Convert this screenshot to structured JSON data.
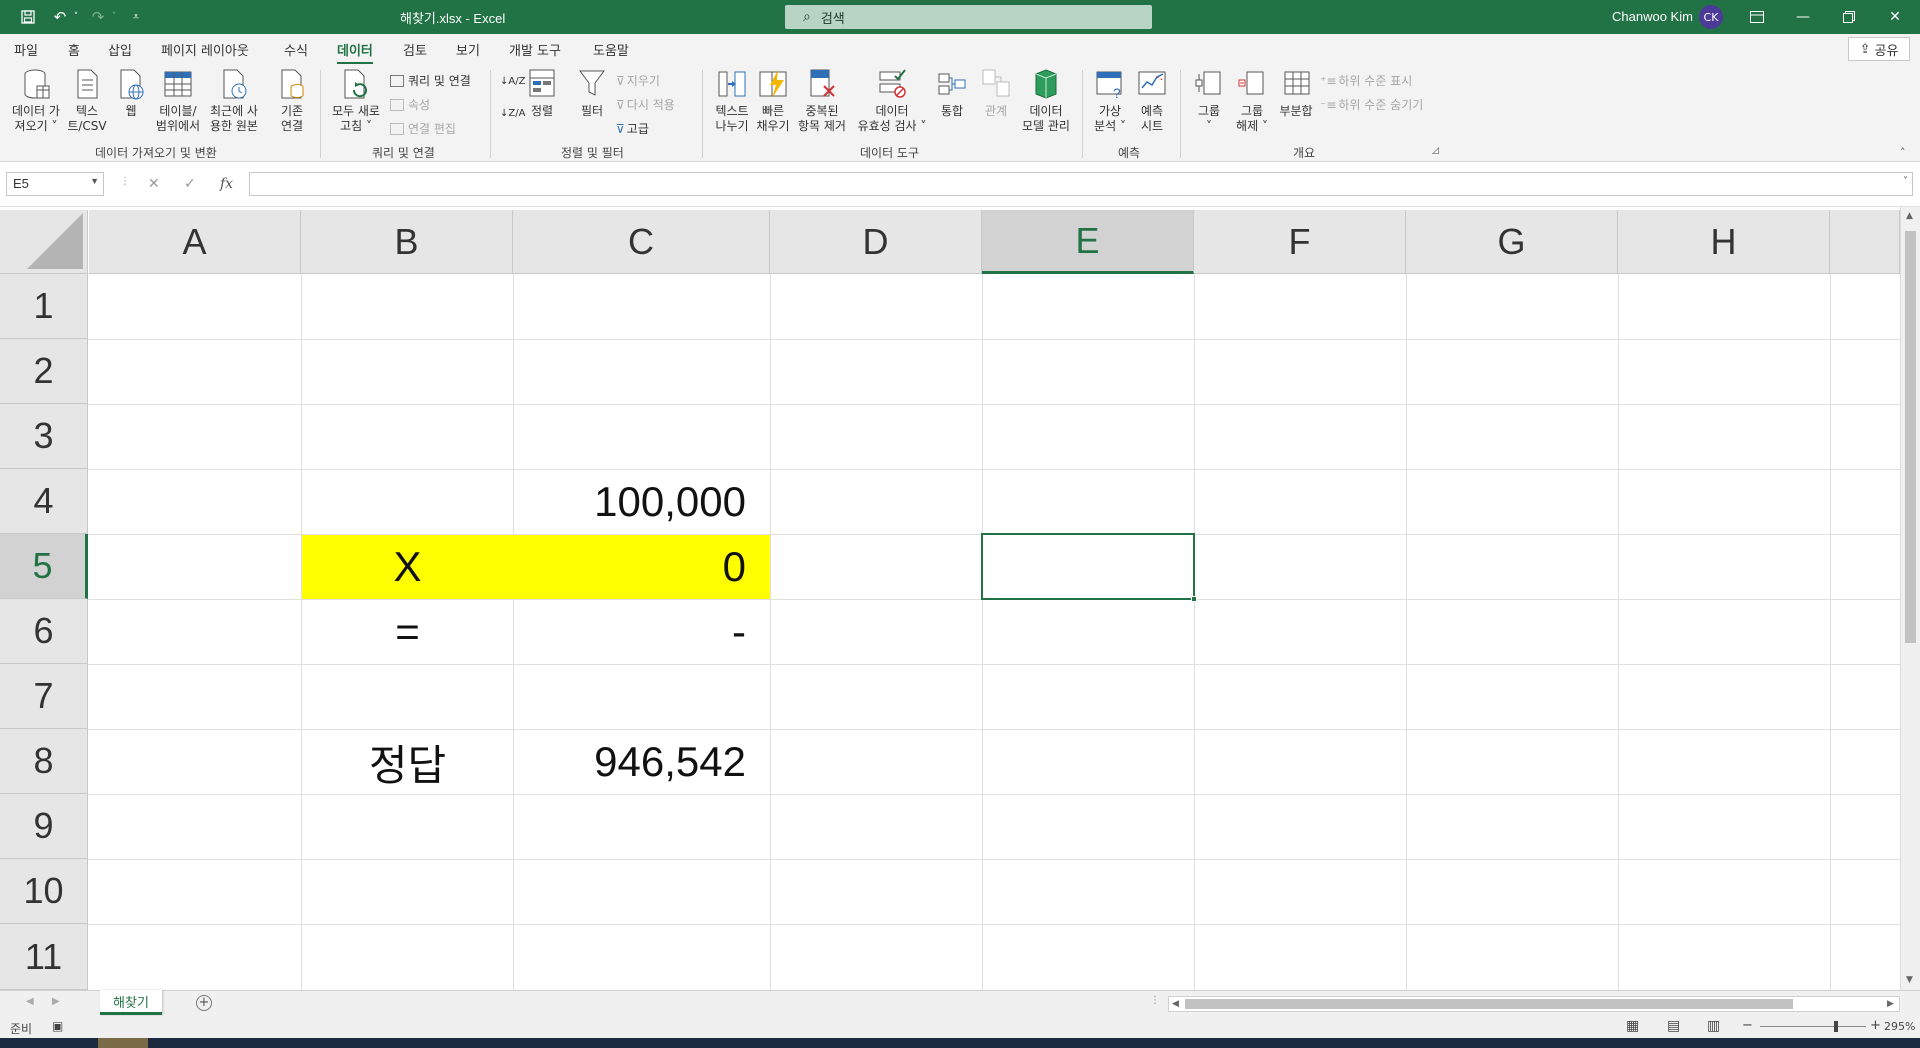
{
  "window": {
    "title": "해찾기.xlsx  -  Excel",
    "search_placeholder": "검색",
    "user_name": "Chanwoo Kim",
    "user_initials": "CK"
  },
  "menu": {
    "tabs": [
      "파일",
      "홈",
      "삽입",
      "페이지 레이아웃",
      "수식",
      "데이터",
      "검토",
      "보기",
      "개발 도구",
      "도움말"
    ],
    "active_tab": "데이터",
    "share_label": "공유"
  },
  "ribbon": {
    "groups": {
      "get_transform": "데이터 가져오기 및 변환",
      "queries": "쿼리 및 연결",
      "sort_filter": "정렬 및 필터",
      "data_tools": "데이터 도구",
      "forecast": "예측",
      "outline": "개요"
    },
    "buttons": {
      "get_data": [
        "데이터 가",
        "져오기 ˅"
      ],
      "text_csv": [
        "텍스",
        "트/CSV"
      ],
      "web": [
        "웹",
        ""
      ],
      "from_table": [
        "테이블/",
        "범위에서"
      ],
      "recent_sources": [
        "최근에 사",
        "용한 원본"
      ],
      "existing_connections": [
        "기존",
        "연결"
      ],
      "refresh_all": [
        "모두 새로",
        "고침 ˅"
      ],
      "queries_connections": "쿼리 및 연결",
      "properties": "속성",
      "edit_links": "연결 편집",
      "sort_asc": "↓A/Z",
      "sort_desc": "↓Z/A",
      "sort": [
        "정렬",
        ""
      ],
      "filter": [
        "필터",
        ""
      ],
      "clear": "지우기",
      "reapply": "다시 적용",
      "advanced": "고급",
      "text_to_columns": [
        "텍스트",
        "나누기"
      ],
      "flash_fill": [
        "빠른",
        "채우기"
      ],
      "remove_duplicates": [
        "중복된",
        "항목 제거"
      ],
      "data_validation": [
        "데이터",
        "유효성 검사 ˅"
      ],
      "consolidate": [
        "통합",
        ""
      ],
      "relationships": [
        "관계",
        ""
      ],
      "data_model": [
        "데이터",
        "모델 관리"
      ],
      "what_if": [
        "가상",
        "분석 ˅"
      ],
      "forecast_sheet": [
        "예측",
        "시트"
      ],
      "group": [
        "그룹",
        "˅"
      ],
      "ungroup": [
        "그룹",
        "해제 ˅"
      ],
      "subtotal": [
        "부분합",
        ""
      ],
      "show_detail": "하위 수준 표시",
      "hide_detail": "하위 수준 숨기기"
    }
  },
  "formula_bar": {
    "name_box": "E5",
    "cancel_icon": "✕",
    "enter_icon": "✓",
    "fx_label": "fx",
    "formula": ""
  },
  "sheet": {
    "columns": [
      "A",
      "B",
      "C",
      "D",
      "E",
      "F",
      "G",
      "H"
    ],
    "rows": [
      "1",
      "2",
      "3",
      "4",
      "5",
      "6",
      "7",
      "8",
      "9",
      "10",
      "11"
    ],
    "selected_cell": "E5",
    "cells": {
      "C4": "100,000",
      "B5": "X",
      "C5": "0",
      "B6": "=",
      "C6": "-",
      "B8": "정답",
      "C8": "946,542"
    },
    "highlight_color": "#ffff00"
  },
  "sheet_tabs": {
    "tabs": [
      "해찾기"
    ],
    "active": "해찾기"
  },
  "status": {
    "ready": "준비",
    "zoom": "295%"
  },
  "colors": {
    "accent": "#217346"
  }
}
